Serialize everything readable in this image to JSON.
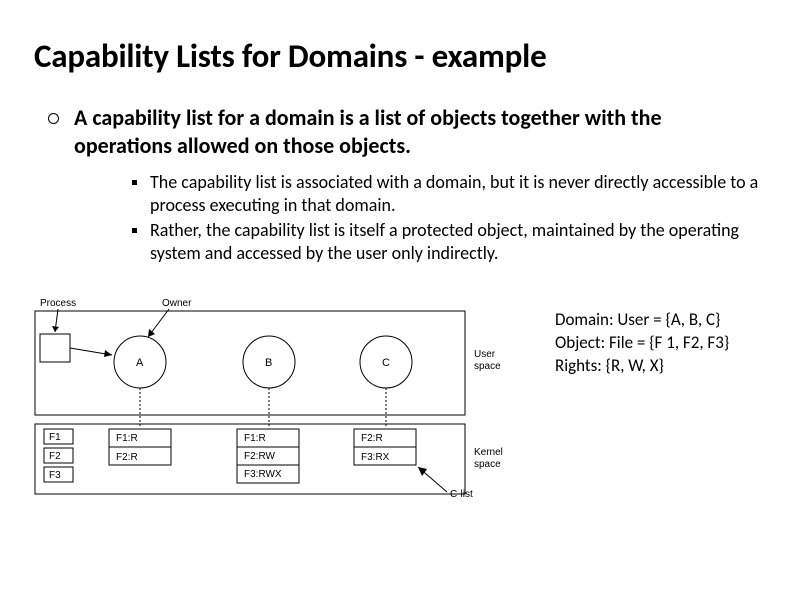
{
  "title": "Capability Lists for Domains -  example",
  "bullet": {
    "prefix": "A ",
    "term": "capability list",
    "rest": " for a domain is a list of objects together with the operations allowed on those objects."
  },
  "sub": [
    "The capability list is associated with a domain, but it is never directly accessible to a process executing in that domain.",
    "Rather, the capability list is itself a protected object, maintained by the operating system and accessed by the user only indirectly."
  ],
  "diagram": {
    "process": "Process",
    "owner": "Owner",
    "nodes": [
      "A",
      "B",
      "C"
    ],
    "f1": "F1",
    "f2": "F2",
    "f3": "F3",
    "col1": [
      "F1:R",
      "F2:R"
    ],
    "col2": [
      "F1:R",
      "F2:RW",
      "F3:RWX"
    ],
    "col3": [
      "F2:R",
      "F3:RX"
    ],
    "user_space": "User\nspace",
    "kernel_space": "Kernel\nspace",
    "clist": "C-list"
  },
  "defs": {
    "domain": "Domain: User = {A, B, C}",
    "object": "Object: File = {F 1, F2, F3}",
    "rights": "Rights: {R, W, X}"
  }
}
